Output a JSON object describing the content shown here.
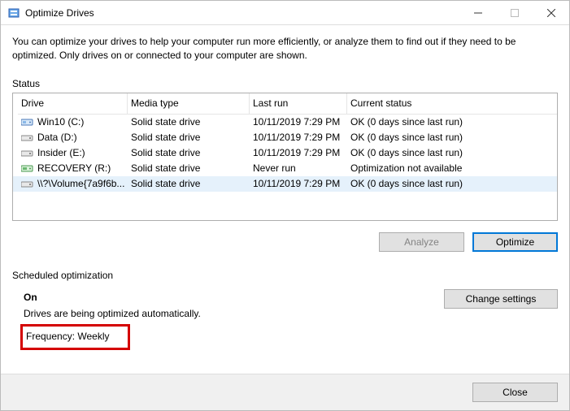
{
  "window": {
    "title": "Optimize Drives"
  },
  "description": "You can optimize your drives to help your computer run more efficiently, or analyze them to find out if they need to be optimized. Only drives on or connected to your computer are shown.",
  "status_label": "Status",
  "table": {
    "headers": {
      "drive": "Drive",
      "media": "Media type",
      "lastrun": "Last run",
      "status": "Current status"
    },
    "rows": [
      {
        "icon": "drive-ssd-icon",
        "name": "Win10 (C:)",
        "media": "Solid state drive",
        "lastrun": "10/11/2019 7:29 PM",
        "status": "OK (0 days since last run)",
        "selected": false
      },
      {
        "icon": "drive-icon",
        "name": "Data (D:)",
        "media": "Solid state drive",
        "lastrun": "10/11/2019 7:29 PM",
        "status": "OK (0 days since last run)",
        "selected": false
      },
      {
        "icon": "drive-icon",
        "name": "Insider (E:)",
        "media": "Solid state drive",
        "lastrun": "10/11/2019 7:29 PM",
        "status": "OK (0 days since last run)",
        "selected": false
      },
      {
        "icon": "drive-recovery-icon",
        "name": "RECOVERY (R:)",
        "media": "Solid state drive",
        "lastrun": "Never run",
        "status": "Optimization not available",
        "selected": false
      },
      {
        "icon": "drive-icon",
        "name": "\\\\?\\Volume{7a9f6b...",
        "media": "Solid state drive",
        "lastrun": "10/11/2019 7:29 PM",
        "status": "OK (0 days since last run)",
        "selected": true
      }
    ]
  },
  "buttons": {
    "analyze": "Analyze",
    "optimize": "Optimize",
    "change_settings": "Change settings",
    "close": "Close"
  },
  "schedule": {
    "section_label": "Scheduled optimization",
    "state": "On",
    "detail": "Drives are being optimized automatically.",
    "frequency": "Frequency: Weekly"
  }
}
